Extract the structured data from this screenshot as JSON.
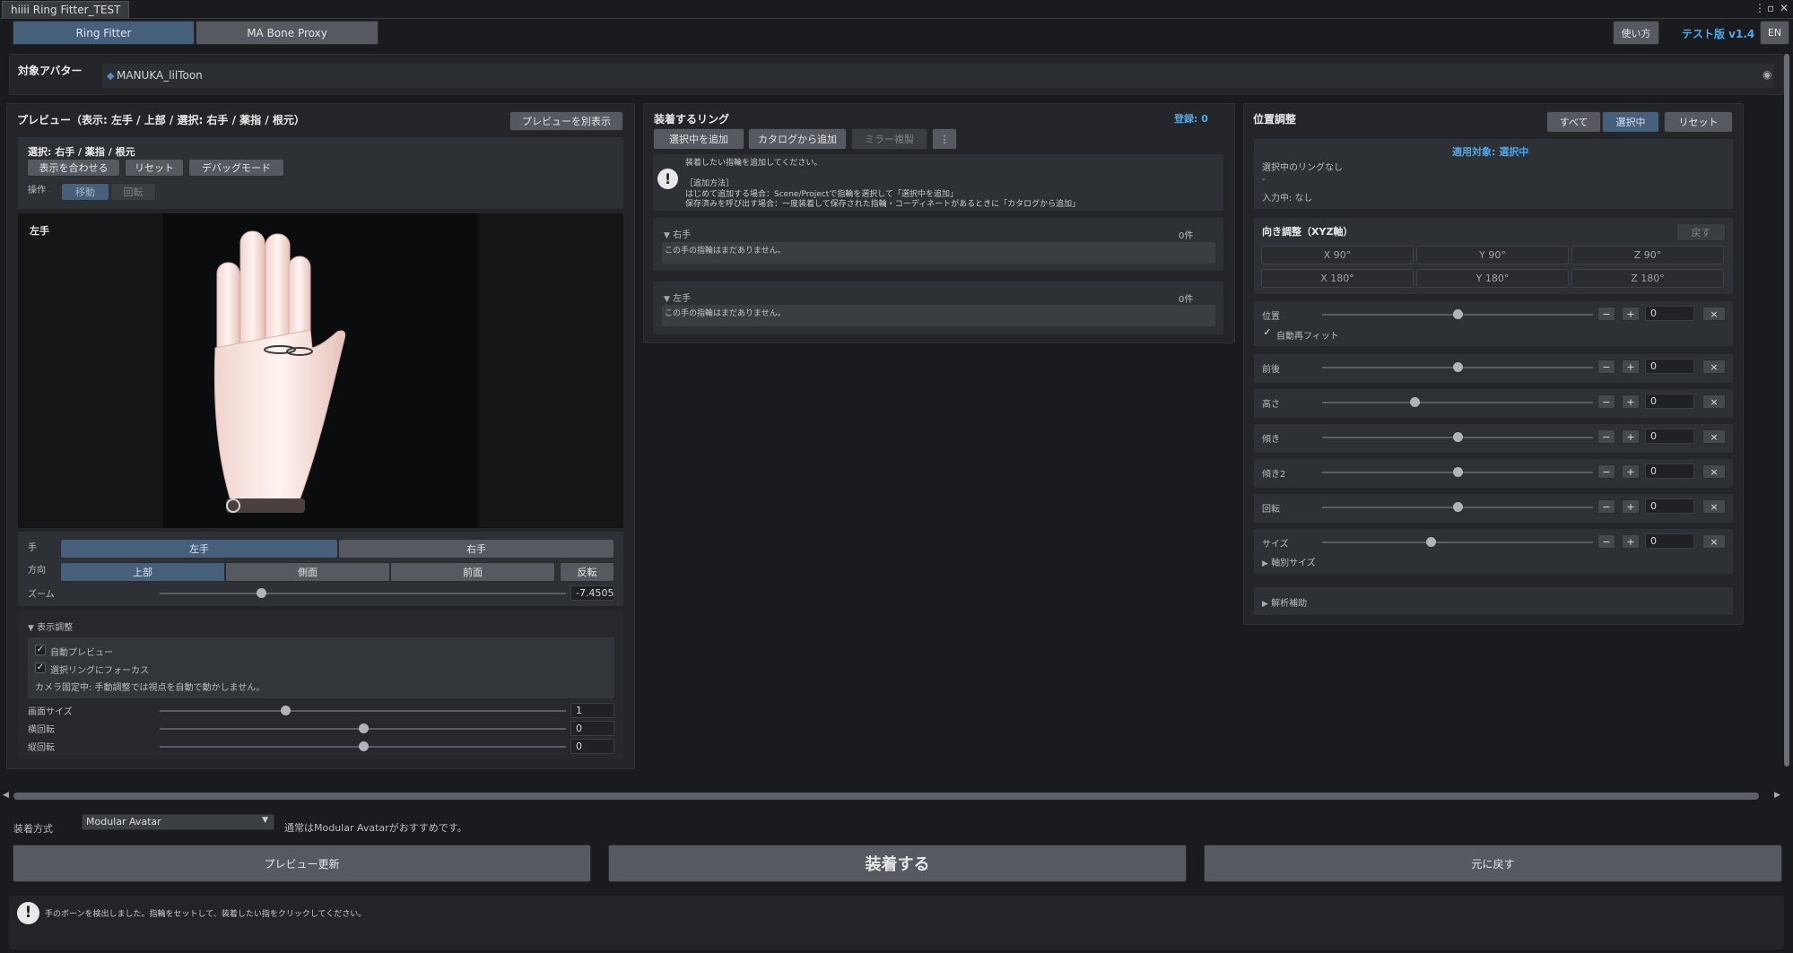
{
  "window": {
    "tab_title": "hiiii Ring Fitter_TEST"
  },
  "header": {
    "tabs": [
      {
        "label": "Ring Fitter"
      },
      {
        "label": "MA Bone Proxy"
      }
    ],
    "help_label": "使い方",
    "version_label": "テスト版 v1.4",
    "lang_label": "EN"
  },
  "avatar": {
    "label": "対象アバター",
    "value": "MANUKA_lilToon"
  },
  "preview": {
    "title": "プレビュー（表示: 左手 / 上部 / 選択: 右手 / 薬指 / 根元）",
    "separate_button": "プレビューを別表示",
    "selection_label": "選択: 右手 / 薬指 / 根元",
    "fit_button": "表示を合わせる",
    "reset_button": "リセット",
    "debug_button": "デバッグモード",
    "operation_label": "操作",
    "move_label": "移動",
    "rotate_label": "回転",
    "viewport_label": "左手",
    "hand_label": "手",
    "hand_left": "左手",
    "hand_right": "右手",
    "direction_label": "方向",
    "dir_top": "上部",
    "dir_side": "側面",
    "dir_front": "前面",
    "flip_button": "反転",
    "zoom_label": "ズーム",
    "zoom_value": "-7.4505",
    "zoom_level": 0.25
  },
  "display": {
    "header": "表示調整",
    "auto_preview": "自動プレビュー",
    "focus_ring": "選択リングにフォーカス",
    "camera_note": "カメラ固定中: 手動調整では視点を自動で動かしません。",
    "screen_size_label": "画面サイズ",
    "screen_size_value": "1",
    "screen_size_level": 0.31,
    "hrot_label": "横回転",
    "hrot_value": "0",
    "hrot_level": 0.5,
    "vrot_label": "縦回転",
    "vrot_value": "0",
    "vrot_level": 0.5
  },
  "rings": {
    "title": "装着するリング",
    "count_label": "登録: 0",
    "add_selected": "選択中を追加",
    "add_catalog": "カタログから追加",
    "mirror": "ミラー複製",
    "more_icon": "⋮",
    "info_line1": "装着したい指輪を追加してください。",
    "info_line2": "［追加方法］",
    "info_line3": "はじめて追加する場合：Scene/Projectで指輪を選択して「選択中を追加」",
    "info_line4": "保存済みを呼び出す場合：一度装着して保存された指輪・コーディネートがあるときに「カタログから追加」",
    "right_label": "右手",
    "right_count": "0件",
    "right_empty": "この手の指輪はまだありません。",
    "left_label": "左手",
    "left_count": "0件",
    "left_empty": "この手の指輪はまだありません。"
  },
  "position": {
    "title": "位置調整",
    "all": "すべて",
    "selected": "選択中",
    "reset": "リセット",
    "target": "適用対象: 選択中",
    "no_ring": "選択中のリングなし",
    "dash": "-",
    "input": "入力中: なし",
    "orient_title": "向き調整（XYZ軸）",
    "back": "戻す",
    "x90": "X 90°",
    "y90": "Y 90°",
    "z90": "Z 90°",
    "x180": "X 180°",
    "y180": "Y 180°",
    "z180": "Z 180°",
    "minus": "−",
    "plus": "+",
    "clear": "×",
    "pos_label": "位置",
    "pos_value": "0",
    "pos_level": 0.5,
    "auto_refit": "自動再フィット",
    "fb_label": "前後",
    "fb_value": "0",
    "fb_level": 0.5,
    "h_label": "高さ",
    "h_value": "0",
    "h_level": 0.34,
    "tilt_label": "傾き",
    "tilt_value": "0",
    "tilt_level": 0.5,
    "tilt2_label": "傾き2",
    "tilt2_value": "0",
    "tilt2_level": 0.5,
    "rot_label": "回転",
    "rot_value": "0",
    "rot_level": 0.5,
    "size_label": "サイズ",
    "size_value": "0",
    "size_level": 0.4,
    "axis_size": "軸別サイズ",
    "analysis": "解析補助"
  },
  "footer": {
    "method_label": "装着方式",
    "method_value": "Modular Avatar",
    "method_note": "通常はModular Avatarがおすすめです。",
    "preview_update": "プレビュー更新",
    "equip": "装着する",
    "revert": "元に戻す",
    "status": "手のボーンを検出しました。指輪をセットして、装着したい指をクリックしてください。"
  },
  "colors": {
    "accent": "#46607c",
    "link_blue": "#4fa8e8"
  }
}
